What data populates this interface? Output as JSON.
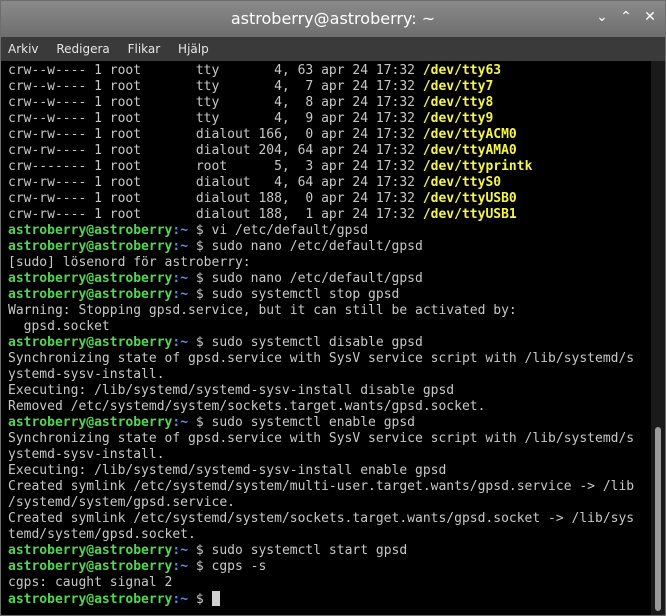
{
  "window": {
    "title": "astroberry@astroberry: ~",
    "buttons": [
      "⌄",
      "⌃",
      "✕"
    ]
  },
  "menu": [
    "Arkiv",
    "Redigera",
    "Flikar",
    "Hjälp"
  ],
  "prompt": {
    "user": "astroberry@astroberry",
    "path": ":~ ",
    "symbol": "$ "
  },
  "lines": [
    {
      "type": "dev",
      "perms": "crw--w---- 1 root       tty       4, 63 apr 24 17:32 ",
      "dev": "/dev/tty63"
    },
    {
      "type": "dev",
      "perms": "crw--w---- 1 root       tty       4,  7 apr 24 17:32 ",
      "dev": "/dev/tty7"
    },
    {
      "type": "dev",
      "perms": "crw--w---- 1 root       tty       4,  8 apr 24 17:32 ",
      "dev": "/dev/tty8"
    },
    {
      "type": "dev",
      "perms": "crw--w---- 1 root       tty       4,  9 apr 24 17:32 ",
      "dev": "/dev/tty9"
    },
    {
      "type": "dev",
      "perms": "crw-rw---- 1 root       dialout 166,  0 apr 24 17:32 ",
      "dev": "/dev/ttyACM0"
    },
    {
      "type": "dev",
      "perms": "crw-rw---- 1 root       dialout 204, 64 apr 24 17:32 ",
      "dev": "/dev/ttyAMA0"
    },
    {
      "type": "dev",
      "perms": "crw------- 1 root       root      5,  3 apr 24 17:32 ",
      "dev": "/dev/ttyprintk"
    },
    {
      "type": "dev",
      "perms": "crw-rw---- 1 root       dialout   4, 64 apr 24 17:32 ",
      "dev": "/dev/ttyS0"
    },
    {
      "type": "dev",
      "perms": "crw-rw---- 1 root       dialout 188,  0 apr 24 17:32 ",
      "dev": "/dev/ttyUSB0"
    },
    {
      "type": "dev",
      "perms": "crw-rw---- 1 root       dialout 188,  1 apr 24 17:32 ",
      "dev": "/dev/ttyUSB1"
    },
    {
      "type": "cmd",
      "text": "vi /etc/default/gpsd"
    },
    {
      "type": "cmd",
      "text": "sudo nano /etc/default/gpsd"
    },
    {
      "type": "out",
      "text": "[sudo] lösenord för astroberry:"
    },
    {
      "type": "cmd",
      "text": "sudo nano /etc/default/gpsd"
    },
    {
      "type": "cmd",
      "text": "sudo systemctl stop gpsd"
    },
    {
      "type": "out",
      "text": "Warning: Stopping gpsd.service, but it can still be activated by:"
    },
    {
      "type": "out",
      "text": "  gpsd.socket"
    },
    {
      "type": "cmd",
      "text": "sudo systemctl disable gpsd"
    },
    {
      "type": "out",
      "text": "Synchronizing state of gpsd.service with SysV service script with /lib/systemd/s"
    },
    {
      "type": "out",
      "text": "ystemd-sysv-install."
    },
    {
      "type": "out",
      "text": "Executing: /lib/systemd/systemd-sysv-install disable gpsd"
    },
    {
      "type": "out",
      "text": "Removed /etc/systemd/system/sockets.target.wants/gpsd.socket."
    },
    {
      "type": "cmd",
      "text": "sudo systemctl enable gpsd"
    },
    {
      "type": "out",
      "text": "Synchronizing state of gpsd.service with SysV service script with /lib/systemd/s"
    },
    {
      "type": "out",
      "text": "ystemd-sysv-install."
    },
    {
      "type": "out",
      "text": "Executing: /lib/systemd/systemd-sysv-install enable gpsd"
    },
    {
      "type": "out",
      "text": "Created symlink /etc/systemd/system/multi-user.target.wants/gpsd.service -> /lib"
    },
    {
      "type": "out",
      "text": "/systemd/system/gpsd.service."
    },
    {
      "type": "out",
      "text": "Created symlink /etc/systemd/system/sockets.target.wants/gpsd.socket -> /lib/sys"
    },
    {
      "type": "out",
      "text": "temd/system/gpsd.socket."
    },
    {
      "type": "cmd",
      "text": "sudo systemctl start gpsd"
    },
    {
      "type": "cmd",
      "text": "cgps -s"
    },
    {
      "type": "out",
      "text": "cgps: caught signal 2"
    },
    {
      "type": "cmd",
      "text": "",
      "cursor": true
    }
  ],
  "colors": {
    "user": "#4fd84f",
    "path": "#5a8cf0",
    "device": "#f4f44a",
    "text": "#c8c8c8"
  }
}
